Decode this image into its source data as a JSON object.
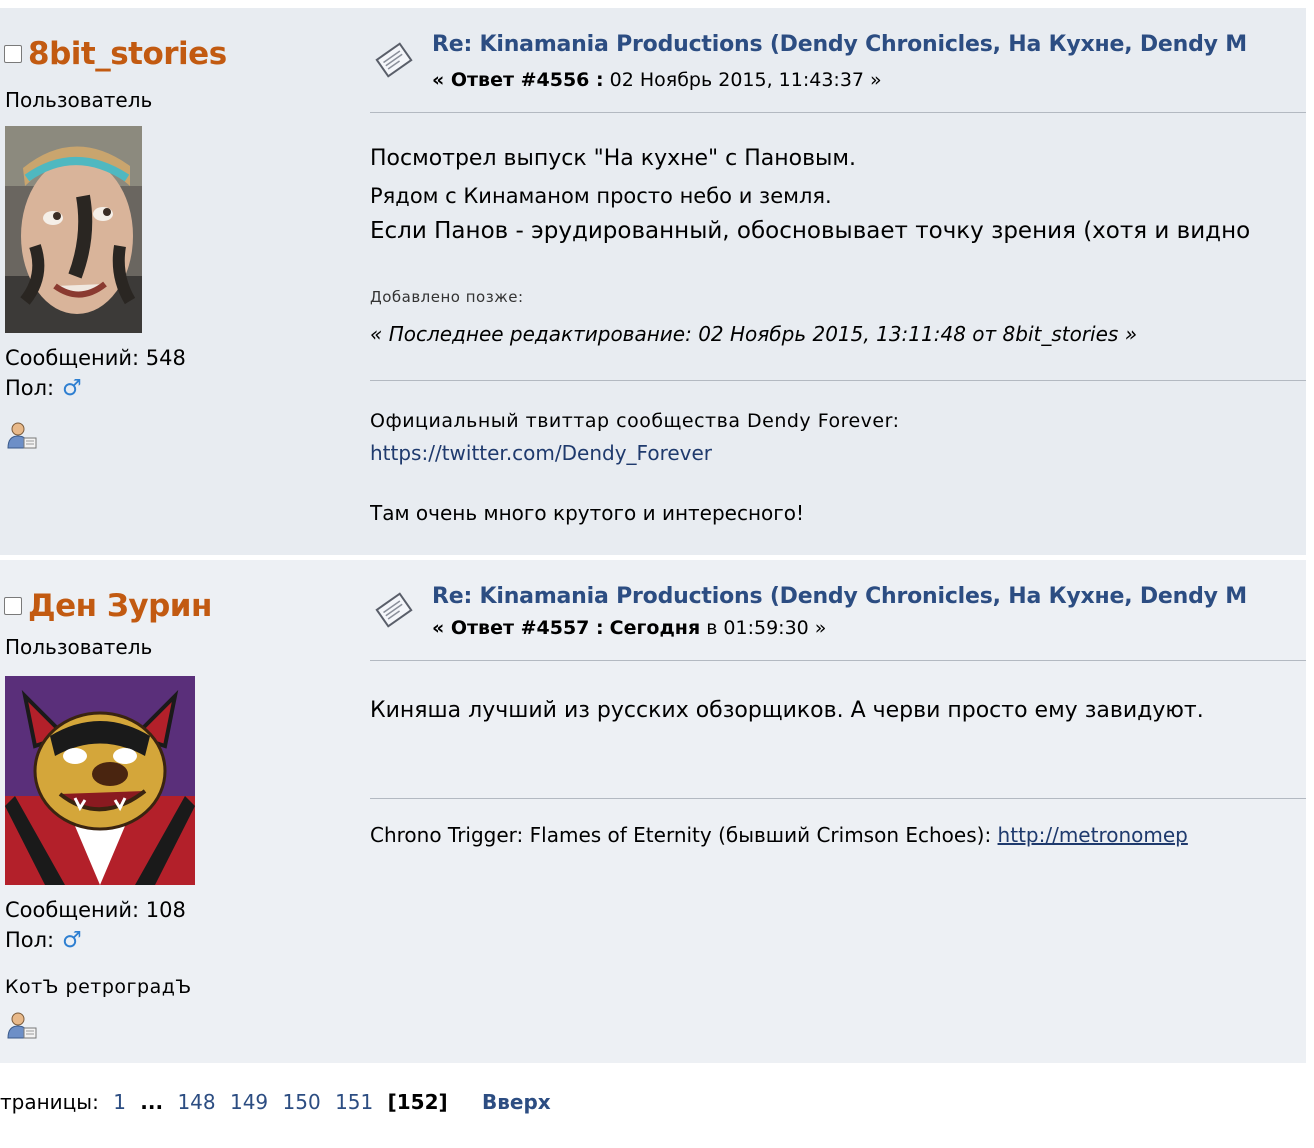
{
  "posts": [
    {
      "username": "8bit_stories",
      "group": "Пользователь",
      "messages_label": "Сообщений: 548",
      "gender_label": "Пол:",
      "gender_icon": "male-icon",
      "subject": "Re: Kinamania Productions (Dendy Chronicles, На Кухне, Dendy M",
      "reply_prefix": "« Ответ #4556 :",
      "reply_date": "02 Ноябрь 2015, 11:43:37 »",
      "body_lines": [
        "Посмотрел выпуск \"На кухне\" с Пановым.",
        "Рядом с Кинаманом просто небо и земля.",
        "Если Панов - эрудированный, обосновывает точку зрения (хотя и видно"
      ],
      "added_later": "Добавлено позже:",
      "last_edit": "« Последнее редактирование: 02 Ноябрь 2015, 13:11:48 от 8bit_stories »",
      "signature_title": "Официальный твиттар сообщества Dendy Forever:",
      "signature_link": "https://twitter.com/Dendy_Forever",
      "signature_extra": "Там очень много крутого и интересного!"
    },
    {
      "username": "Ден Зурин",
      "group": "Пользователь",
      "messages_label": "Сообщений: 108",
      "gender_label": "Пол:",
      "gender_icon": "male-icon",
      "custom_title": "КотЪ ретроградЪ",
      "subject": "Re: Kinamania Productions (Dendy Chronicles, На Кухне, Dendy M",
      "reply_prefix": "« Ответ #4557 :",
      "reply_bold": "Сегодня",
      "reply_date": "в 01:59:30 »",
      "body_lines": [
        "Киняша лучший из русских обзорщиков. А черви просто ему завидуют."
      ],
      "signature_text": "Chrono Trigger: Flames of Eternity (бывший Crimson Echoes):",
      "signature_link": "http://metronomep"
    }
  ],
  "pagination": {
    "label": "траницы:",
    "pages": [
      "1",
      "...",
      "148",
      "149",
      "150",
      "151"
    ],
    "current": "[152]",
    "up": "Вверх"
  },
  "colors": {
    "username": "#c25a11",
    "subject": "#2c4d82",
    "post_bg": "#e8ecf1",
    "gender": "#2e7fd1"
  }
}
